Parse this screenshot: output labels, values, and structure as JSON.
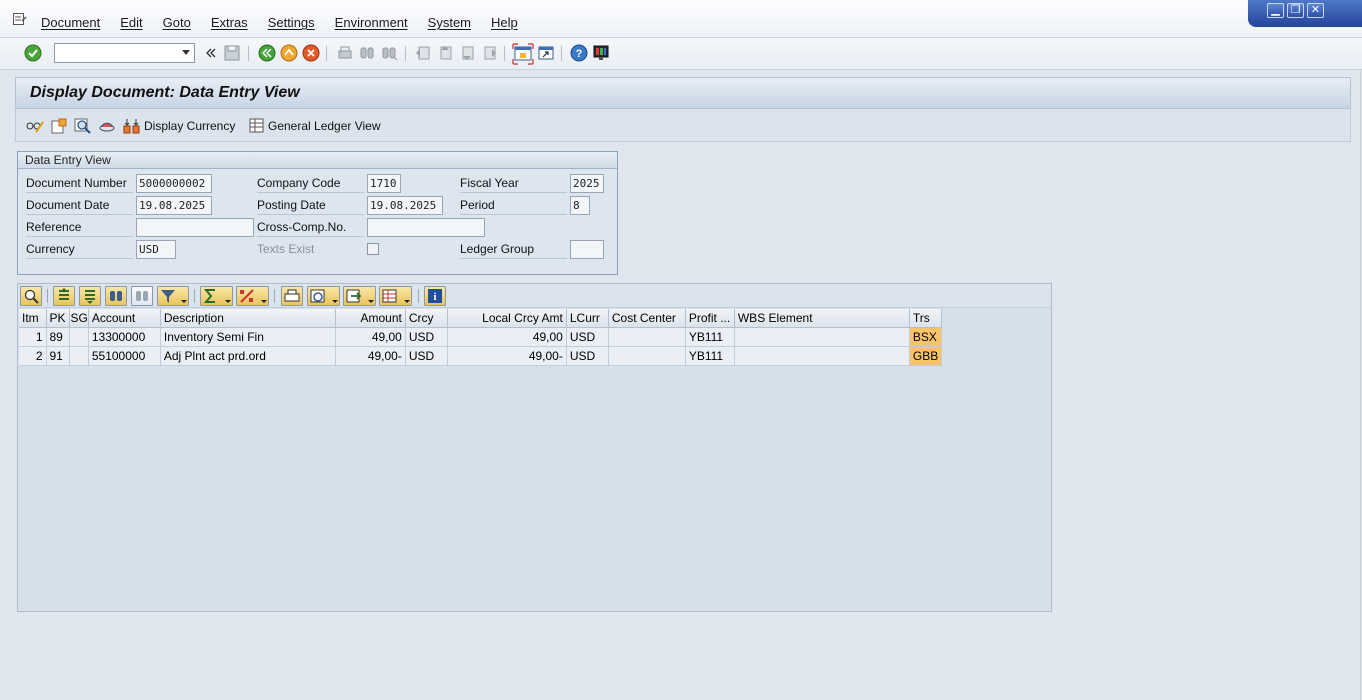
{
  "menu": {
    "items": [
      "Document",
      "Edit",
      "Goto",
      "Extras",
      "Settings",
      "Environment",
      "System",
      "Help"
    ]
  },
  "window_controls": {
    "minimize": "▁",
    "restore": "❐",
    "close": "✕"
  },
  "toolbar": {
    "command_field_value": "",
    "icons": [
      "enter-icon",
      "command-field",
      "back-double-icon",
      "save-icon",
      "back-icon",
      "exit-icon",
      "cancel-icon",
      "print-icon",
      "find-icon",
      "find-next-icon",
      "first-page-icon",
      "previous-page-icon",
      "next-page-icon",
      "last-page-icon",
      "create-session-icon",
      "shortcut-icon",
      "help-icon",
      "layout-icon"
    ]
  },
  "page": {
    "title": "Display Document: Data Entry View"
  },
  "app_toolbar": {
    "display_currency": "Display Currency",
    "general_ledger_view": "General Ledger View"
  },
  "header": {
    "group_title": "Data Entry View",
    "document_number_label": "Document Number",
    "document_number": "5000000002",
    "company_code_label": "Company Code",
    "company_code": "1710",
    "fiscal_year_label": "Fiscal Year",
    "fiscal_year": "2025",
    "document_date_label": "Document Date",
    "document_date": "19.08.2025",
    "posting_date_label": "Posting Date",
    "posting_date": "19.08.2025",
    "period_label": "Period",
    "period": "8",
    "reference_label": "Reference",
    "reference": "",
    "cross_comp_label": "Cross-Comp.No.",
    "cross_comp": "",
    "currency_label": "Currency",
    "currency": "USD",
    "texts_exist_label": "Texts Exist",
    "ledger_group_label": "Ledger Group",
    "ledger_group": ""
  },
  "grid": {
    "columns": {
      "itm": "Itm",
      "pk": "PK",
      "sg": "SG",
      "account": "Account",
      "description": "Description",
      "amount": "Amount",
      "crcy": "Crcy",
      "local_amt": "Local Crcy Amt",
      "lcurr": "LCurr",
      "cost_center": "Cost Center",
      "profit": "Profit ...",
      "wbs": "WBS Element",
      "trs": "Trs"
    },
    "rows": [
      {
        "itm": "1",
        "pk": "89",
        "sg": "",
        "account": "13300000",
        "description": "Inventory Semi Fin",
        "amount": "49,00",
        "crcy": "USD",
        "local_amt": "49,00",
        "lcurr": "USD",
        "cost_center": "",
        "profit": "YB111",
        "wbs": "",
        "trs": "BSX"
      },
      {
        "itm": "2",
        "pk": "91",
        "sg": "",
        "account": "55100000",
        "description": "Adj Plnt act prd.ord",
        "amount": "49,00-",
        "crcy": "USD",
        "local_amt": "49,00-",
        "lcurr": "USD",
        "cost_center": "",
        "profit": "YB111",
        "wbs": "",
        "trs": "GBB"
      }
    ]
  }
}
